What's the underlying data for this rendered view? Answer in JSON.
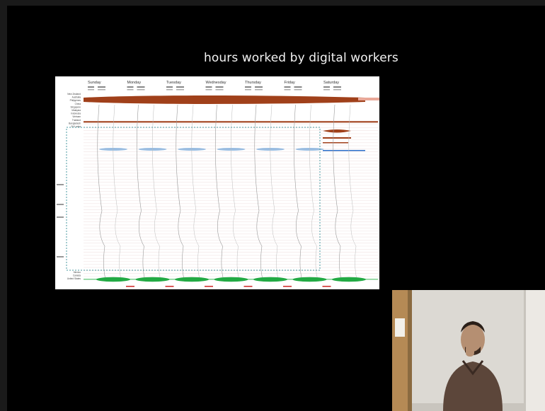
{
  "slide": {
    "title": "hours worked by digital workers",
    "background_color": "#000000"
  },
  "chart": {
    "days": [
      "Sunday",
      "Monday",
      "Tuesday",
      "Wednesday",
      "Thursday",
      "Friday",
      "Saturday"
    ],
    "country_labels_top": [
      "New Zealand",
      "Australia",
      "Philippines",
      "China",
      "Singapore",
      "Malaysia",
      "Indonesia",
      "Vietnam",
      "Thailand",
      "Bangladesh",
      "Sri Lanka"
    ],
    "country_labels_bottom": [
      "Mexico",
      "Canada",
      "United States"
    ],
    "colors": {
      "asia_band": "#a0401a",
      "europe_band": "#7aa8d8",
      "americas_band": "#22aa44",
      "selection_box": "#4a9aa0",
      "marker": "#d03030"
    }
  },
  "presenter_video": {
    "wall_color": "#d9d6d1"
  }
}
